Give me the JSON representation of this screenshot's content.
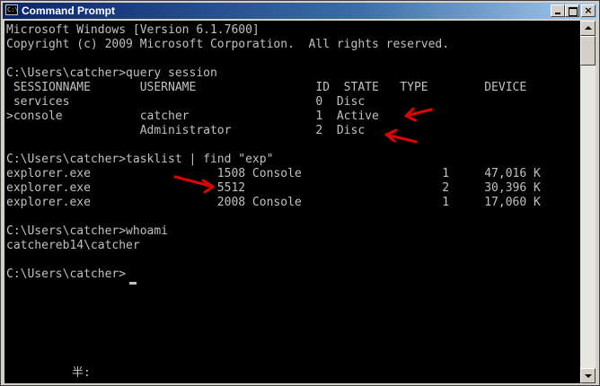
{
  "window": {
    "title": "Command Prompt",
    "icon_text": "C:\\"
  },
  "title_buttons": {
    "minimize": "minimize",
    "maximize": "maximize",
    "close": "×"
  },
  "console": {
    "lines": [
      "Microsoft Windows [Version 6.1.7600]",
      "Copyright (c) 2009 Microsoft Corporation.  All rights reserved.",
      "",
      "C:\\Users\\catcher>query session",
      " SESSIONNAME       USERNAME                 ID  STATE   TYPE        DEVICE",
      " services                                   0  Disc",
      ">console           catcher                  1  Active",
      "                   Administrator            2  Disc",
      "",
      "C:\\Users\\catcher>tasklist | find \"exp\"",
      "explorer.exe                  1508 Console                    1     47,016 K",
      "explorer.exe                  5512                            2     30,396 K",
      "explorer.exe                  2008 Console                    1     17,060 K",
      "",
      "C:\\Users\\catcher>whoami",
      "catchereb14\\catcher",
      "",
      "C:\\Users\\catcher>"
    ],
    "ime_indicator": "半:"
  },
  "annotation_color": "#e00000",
  "colors": {
    "console_bg": "#000000",
    "console_fg": "#c0c0c0",
    "titlebar_start": "#0a246a",
    "titlebar_end": "#a6caf0"
  }
}
